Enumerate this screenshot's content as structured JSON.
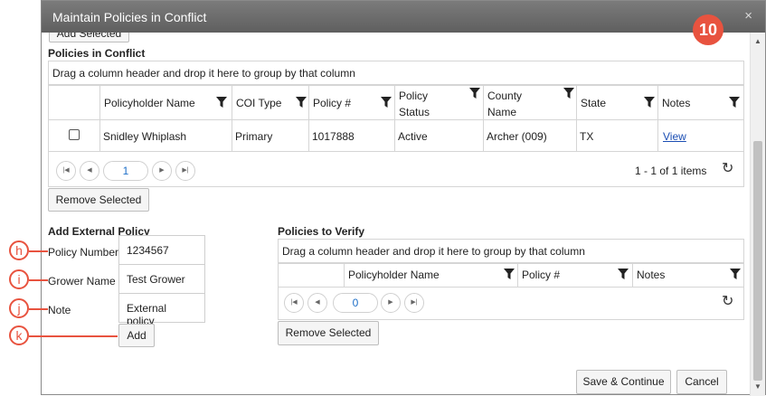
{
  "dialog": {
    "title": "Maintain Policies in Conflict",
    "close_label": "×"
  },
  "step_badge": "10",
  "top_button": "Add Selected",
  "conflict": {
    "title": "Policies in Conflict",
    "group_hint": "Drag a column header and drop it here to group by that column",
    "columns": [
      "Policyholder Name",
      "COI Type",
      "Policy #",
      "Policy Status",
      "County Name",
      "State",
      "Notes"
    ],
    "rows": [
      {
        "name": "Snidley Whiplash",
        "coi_type": "Primary",
        "policy": "1017888",
        "status": "Active",
        "county": "Archer (009)",
        "state": "TX",
        "notes": "View"
      }
    ],
    "pager": {
      "page": "1",
      "info": "1 - 1 of 1 items"
    },
    "remove_button": "Remove Selected"
  },
  "external": {
    "title": "Add External Policy",
    "fields": [
      {
        "label": "Policy Number",
        "value": "1234567"
      },
      {
        "label": "Grower Name",
        "value": "Test Grower"
      },
      {
        "label": "Note",
        "value": "External policy"
      }
    ],
    "add_button": "Add"
  },
  "verify": {
    "title": "Policies to Verify",
    "group_hint": "Drag a column header and drop it here to group by that column",
    "columns": [
      "Policyholder Name",
      "Policy #",
      "Notes"
    ],
    "pager": {
      "page": "0"
    },
    "remove_button": "Remove Selected"
  },
  "footer": {
    "save_button": "Save & Continue",
    "cancel_button": "Cancel"
  },
  "callouts": [
    "h",
    "i",
    "j",
    "k"
  ],
  "colors": {
    "accent": "#e8533f",
    "titlebar": "#6b6b6b",
    "link": "#1a4db3",
    "pager_active": "#1e6fc8"
  }
}
